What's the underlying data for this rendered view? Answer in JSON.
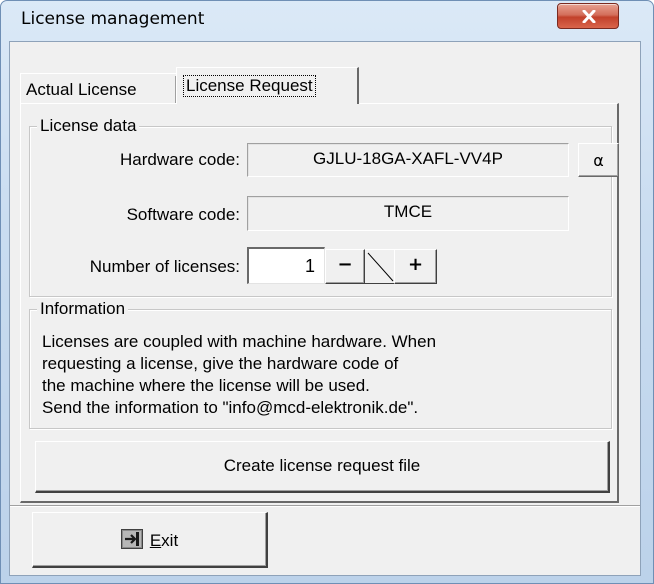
{
  "window": {
    "title": "License management"
  },
  "tabs": [
    {
      "label": "Actual License",
      "selected": false
    },
    {
      "label": "License Request",
      "selected": true
    }
  ],
  "license_data": {
    "group_label": "License data",
    "hardware_code": {
      "label": "Hardware code:",
      "value": "GJLU-18GA-XAFL-VV4P"
    },
    "alpha_button_label": "α",
    "software_code": {
      "label": "Software code:",
      "value": "TMCE"
    },
    "number_of_licenses": {
      "label": "Number of licenses:",
      "value": "1",
      "minus_label": "−",
      "plus_label": "+"
    }
  },
  "information": {
    "group_label": "Information",
    "lines": [
      "Licenses are coupled with machine hardware. When",
      "requesting a license, give the hardware code of",
      "the machine where the license will be used.",
      "Send the information to \"info@mcd-elektronik.de\"."
    ]
  },
  "actions": {
    "create_request_label": "Create license request file",
    "exit_accel": "E",
    "exit_rest": "xit"
  },
  "icons": {
    "close": "close-icon",
    "exit": "exit-door-icon"
  },
  "colors": {
    "close_button": "#c2412b",
    "dialog_face": "#f0f0f0",
    "frame": "#c9dcf0"
  }
}
